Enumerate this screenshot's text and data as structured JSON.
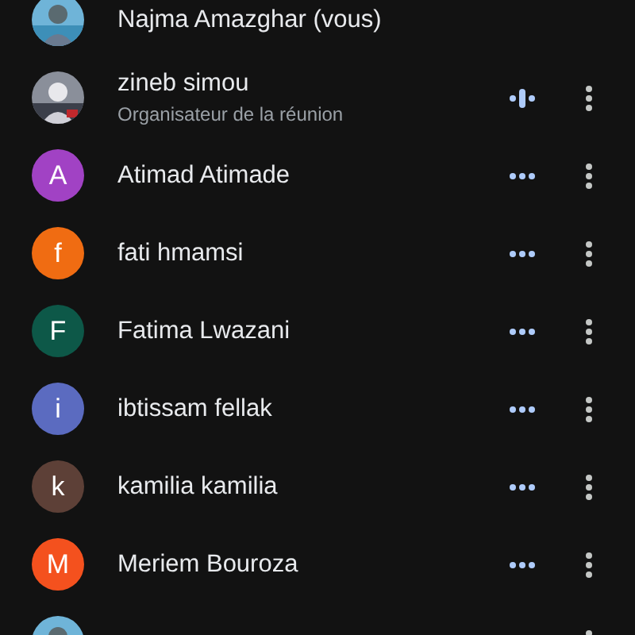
{
  "participants": [
    {
      "name": "Najma Amazghar (vous)",
      "menu": false
    },
    {
      "name": "zineb simou",
      "subtitle": "Organisateur de la réunion",
      "speaking": true,
      "menu": true
    },
    {
      "name": "Atimad Atimade",
      "avatar": {
        "kind": "initial",
        "letter": "A",
        "color": "#a142c4"
      },
      "speaking": false,
      "menu": true
    },
    {
      "name": "fati hmamsi",
      "avatar": {
        "kind": "initial",
        "letter": "f",
        "color": "#f06c12"
      },
      "speaking": false,
      "menu": true
    },
    {
      "name": "Fatima Lwazani",
      "avatar": {
        "kind": "initial",
        "letter": "F",
        "color": "#0d5848"
      },
      "speaking": false,
      "menu": true
    },
    {
      "name": "ibtissam fellak",
      "avatar": {
        "kind": "initial",
        "letter": "i",
        "color": "#5b6bc0"
      },
      "speaking": false,
      "menu": true
    },
    {
      "name": "kamilia kamilia",
      "avatar": {
        "kind": "initial",
        "letter": "k",
        "color": "#5d4037"
      },
      "speaking": false,
      "menu": true
    },
    {
      "name": "Meriem Bouroza",
      "avatar": {
        "kind": "initial",
        "letter": "M",
        "color": "#f4511e"
      },
      "speaking": false,
      "menu": true
    },
    {
      "menu": true
    }
  ]
}
